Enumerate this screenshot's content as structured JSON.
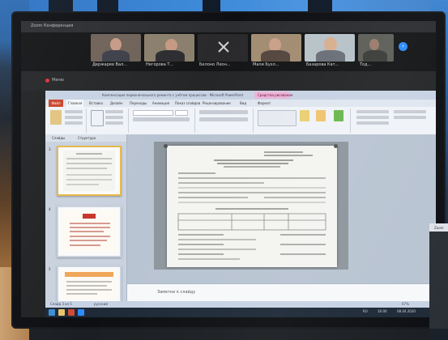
{
  "zoom": {
    "window_title": "Zoom Конференция",
    "recording_label": "Меню",
    "participants": [
      {
        "name": "Держарев Вал..."
      },
      {
        "name": "Негорова Т..."
      },
      {
        "name": "Белоно Леон..."
      },
      {
        "name": "Мали Бузл..."
      },
      {
        "name": "Базарова Кат..."
      },
      {
        "name": "Тод..."
      }
    ],
    "next_icon": "chevron-right-icon"
  },
  "powerpoint": {
    "title": "Компенсация первоначального ремонта с учётом процессов - Microsoft PowerPoint",
    "context_tab": "Средства рисования",
    "file_tab": "Файл",
    "tabs": [
      "Главная",
      "Вставка",
      "Дизайн",
      "Переходы",
      "Анимация",
      "Показ слайдов",
      "Рецензирование",
      "Вид",
      "Формат"
    ],
    "panel_tabs": [
      "Слайды",
      "Структура"
    ],
    "notes_placeholder": "Заметки к слайду",
    "status": {
      "slide": "Слайд 3 из 5",
      "lang": "русский",
      "zoom": "67%"
    },
    "tray": {
      "lang": "RU",
      "time": "16:00",
      "date": "08.04.2020"
    }
  },
  "side_window": {
    "label": "Zoom"
  }
}
